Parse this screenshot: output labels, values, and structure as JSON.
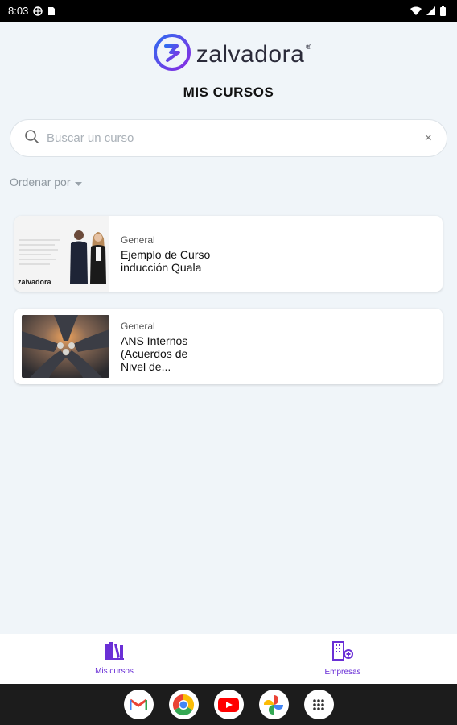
{
  "status_bar": {
    "time": "8:03"
  },
  "app": {
    "brand": "zalvadora",
    "brand_mark": "®",
    "brand_color": "#6a2fd6"
  },
  "page": {
    "title": "MIS CURSOS"
  },
  "search": {
    "placeholder": "Buscar un curso",
    "value": "",
    "clear_icon": "×"
  },
  "sort": {
    "label": "Ordenar por"
  },
  "courses": [
    {
      "category": "General",
      "title": "Ejemplo de Curso inducción Quala",
      "thumb_brand": "zalvadora"
    },
    {
      "category": "General",
      "title": "ANS Internos (Acuerdos de Nivel de..."
    }
  ],
  "bottom_nav": [
    {
      "label": "Mis cursos",
      "icon": "books-icon"
    },
    {
      "label": "Empresas",
      "icon": "building-icon"
    }
  ],
  "dock": [
    "gmail-icon",
    "chrome-icon",
    "youtube-icon",
    "photos-icon",
    "apps-grid-icon"
  ]
}
